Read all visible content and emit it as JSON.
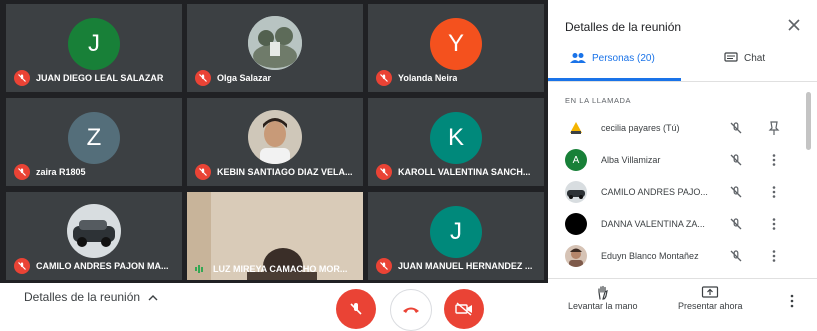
{
  "tiles": [
    {
      "name": "JUAN DIEGO LEAL SALAZAR",
      "initial": "J",
      "color": "#188038"
    },
    {
      "name": "Olga Salazar"
    },
    {
      "name": "Yolanda Neira",
      "initial": "Y",
      "color": "#f4511e"
    },
    {
      "name": "zaira R1805",
      "initial": "Z",
      "color": "#546e7a"
    },
    {
      "name": "KEBIN SANTIAGO DIAZ VELA..."
    },
    {
      "name": "KAROLL VALENTINA SANCH...",
      "initial": "K",
      "color": "#00897b"
    },
    {
      "name": "CAMILO ANDRES PAJON MA..."
    },
    {
      "name": "LUZ MIREYA CAMACHO MOR..."
    },
    {
      "name": "JUAN MANUEL HERNANDEZ ...",
      "initial": "J",
      "color": "#00897b"
    }
  ],
  "bottom": {
    "meeting_details": "Detalles de la reunión"
  },
  "panel": {
    "title": "Detalles de la reunión",
    "tab_people": "Personas (20)",
    "tab_chat": "Chat",
    "section": "EN LA LLAMADA",
    "people": [
      {
        "name": "cecilia payares (Tú)"
      },
      {
        "name": "Alba Villamizar",
        "initial": "A"
      },
      {
        "name": "CAMILO ANDRES PAJO..."
      },
      {
        "name": "DANNA VALENTINA ZA..."
      },
      {
        "name": "Eduyn Blanco Montañez"
      }
    ],
    "raise_hand": "Levantar la mano",
    "present_now": "Presentar ahora"
  },
  "colors": {
    "accent": "#1a73e8",
    "mute_red": "#ea4335",
    "tile_bg": "#3c4043",
    "stage_bg": "#202124"
  }
}
